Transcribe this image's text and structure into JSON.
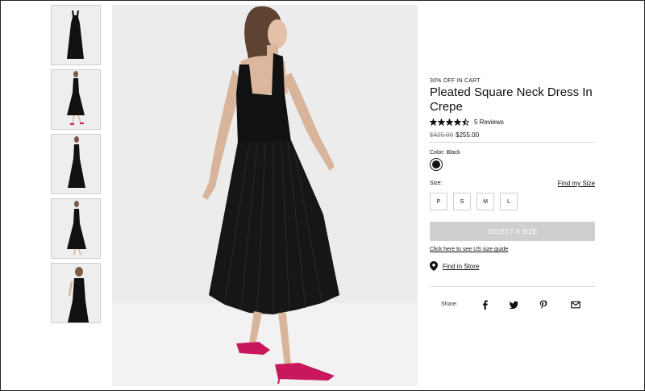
{
  "gallery": {
    "thumbnails": [
      {
        "alt": "front-view"
      },
      {
        "alt": "back-view"
      },
      {
        "alt": "side-view"
      },
      {
        "alt": "back-full-view"
      },
      {
        "alt": "closeup-back-view"
      }
    ]
  },
  "product": {
    "promo": "30% OFF IN CART",
    "title": "Pleated Square Neck Dress In Crepe",
    "rating": 4.5,
    "rating_max": 5,
    "reviews": "5 Reviews",
    "old_price": "$425.00",
    "new_price": "$255.00",
    "color_label": "Color: Black",
    "color_swatch": "#111111",
    "size_label": "Size:",
    "find_size": "Find my Size",
    "sizes": [
      "P",
      "S",
      "M",
      "L"
    ],
    "select_button": "SELECT A SIZE",
    "size_guide": "Click here to see US size guide",
    "find_in_store": "Find in Store",
    "share_label": "Share:",
    "share_icons": [
      "facebook-icon",
      "twitter-icon",
      "pinterest-icon",
      "email-icon"
    ]
  },
  "colors": {
    "button_disabled": "#cfcfcf",
    "image_background": "#ececec",
    "shoe": "#c8175a"
  }
}
